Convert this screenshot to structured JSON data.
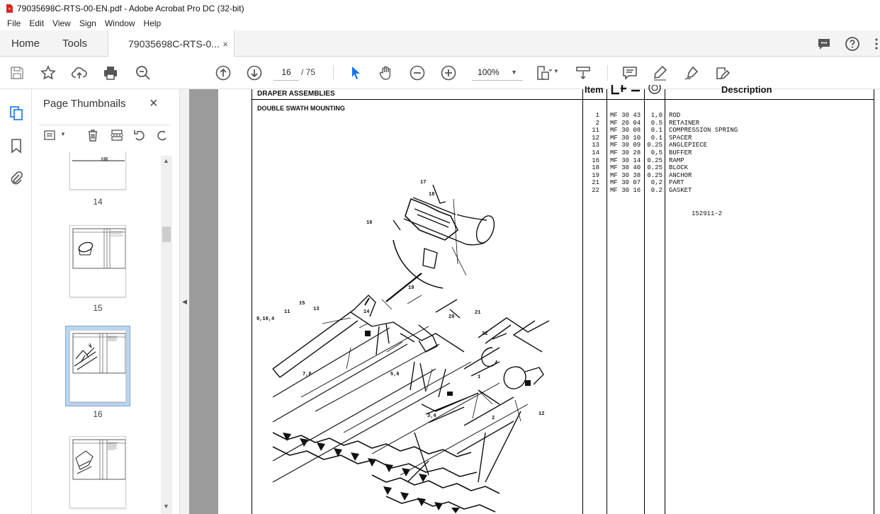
{
  "window": {
    "title": "79035698C-RTS-00-EN.pdf - Adobe Acrobat Pro DC (32-bit)"
  },
  "menu": [
    "File",
    "Edit",
    "View",
    "Sign",
    "Window",
    "Help"
  ],
  "tabs": {
    "home": "Home",
    "tools": "Tools",
    "document": "79035698C-RTS-0...",
    "close": "×"
  },
  "toolbar": {
    "page_current": "16",
    "page_total": "/ 75",
    "zoom": "100%"
  },
  "panel": {
    "title": "Page Thumbnails",
    "close": "×"
  },
  "thumbnails": [
    {
      "label": "14"
    },
    {
      "label": "15"
    },
    {
      "label": "16",
      "selected": true
    },
    {
      "label": ""
    }
  ],
  "document": {
    "section_title": "DRAPER ASSEMBLIES",
    "subtitle": "DOUBLE SWATH MOUNTING",
    "col_item": "Item",
    "col_description": "Description",
    "figure_ref": "152911-2",
    "parts": [
      {
        "item": "1",
        "ref": "MF 30 43",
        "qty": "1,0",
        "desc": "ROD"
      },
      {
        "item": "2",
        "ref": "MF 20 04",
        "qty": "0.5",
        "desc": "RETAINER"
      },
      {
        "item": "11",
        "ref": "MF 30 08",
        "qty": "0.1",
        "desc": "COMPRESSION SPRING"
      },
      {
        "item": "12",
        "ref": "MF 30 10",
        "qty": "0.1",
        "desc": "SPACER"
      },
      {
        "item": "13",
        "ref": "MF 30 09",
        "qty": "0.25",
        "desc": "ANGLEPIECE"
      },
      {
        "item": "14",
        "ref": "MF 30 28",
        "qty": "0,5",
        "desc": "BUFFER"
      },
      {
        "item": "16",
        "ref": "MF 30 14",
        "qty": "0.25",
        "desc": "RAMP"
      },
      {
        "item": "18",
        "ref": "MF 30 40",
        "qty": "0.25",
        "desc": "BLOCK"
      },
      {
        "item": "19",
        "ref": "MF 30 38",
        "qty": "0.25",
        "desc": "ANCHOR"
      },
      {
        "item": "21",
        "ref": "MF 30 07",
        "qty": "0,2",
        "desc": "PART"
      },
      {
        "item": "22",
        "ref": "MF 30 16",
        "qty": "0.2",
        "desc": "GASKET"
      }
    ],
    "callouts": [
      "17",
      "18",
      "16",
      "19",
      "15",
      "13",
      "14",
      "11",
      "9,10,4",
      "20",
      "21",
      "22",
      "7,8",
      "5,6",
      "3,4",
      "1",
      "2",
      "12"
    ]
  }
}
